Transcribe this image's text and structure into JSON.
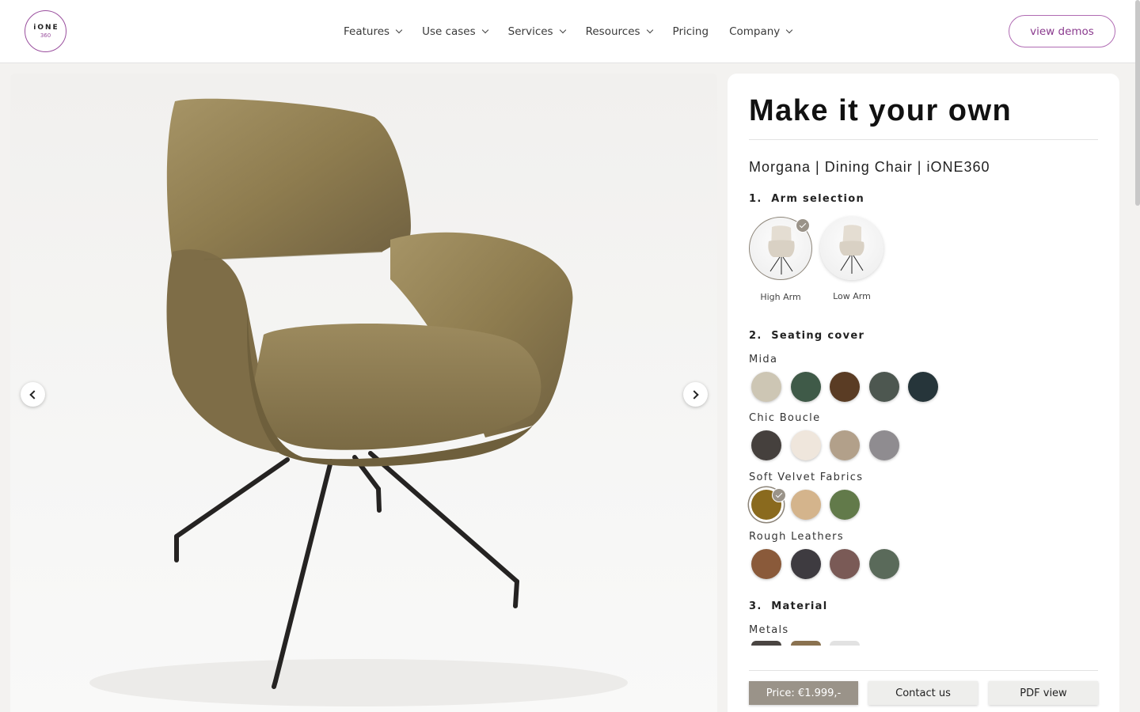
{
  "header": {
    "logo_top": "iONE",
    "logo_bottom": "360",
    "nav": [
      {
        "label": "Features",
        "has_dropdown": true
      },
      {
        "label": "Use cases",
        "has_dropdown": true
      },
      {
        "label": "Services",
        "has_dropdown": true
      },
      {
        "label": "Resources",
        "has_dropdown": true
      },
      {
        "label": "Pricing",
        "has_dropdown": false
      },
      {
        "label": "Company",
        "has_dropdown": true
      }
    ],
    "cta_label": "view demos"
  },
  "viewer": {
    "prev_icon": "chevron-left-icon",
    "next_icon": "chevron-right-icon"
  },
  "config": {
    "title": "Make it your own",
    "product_name": "Morgana | Dining Chair | iONE360",
    "sections": [
      {
        "number": "1.",
        "label": "Arm selection"
      },
      {
        "number": "2.",
        "label": "Seating cover"
      },
      {
        "number": "3.",
        "label": "Material"
      }
    ],
    "arm_options": [
      {
        "label": "High Arm",
        "selected": true
      },
      {
        "label": "Low Arm",
        "selected": false
      }
    ],
    "cover_groups": [
      {
        "name": "Mida",
        "colors": [
          "#cdc6b4",
          "#3f5a48",
          "#5a3c24",
          "#4d5750",
          "#26353a"
        ],
        "selected": null
      },
      {
        "name": "Chic Boucle",
        "colors": [
          "#45403d",
          "#efe6dc",
          "#b2a08a",
          "#8f8c90"
        ],
        "selected": null
      },
      {
        "name": "Soft Velvet Fabrics",
        "colors": [
          "#8a6a1e",
          "#d4b48c",
          "#627a4a"
        ],
        "selected": 0
      },
      {
        "name": "Rough Leathers",
        "colors": [
          "#8a5a3a",
          "#3e3b40",
          "#7a5a56",
          "#5a6a5a"
        ],
        "selected": null
      }
    ],
    "material_groups": [
      {
        "name": "Metals",
        "colors": [
          "#4a4542",
          "#8a7250",
          "#e2e2e2"
        ]
      }
    ],
    "buttons": {
      "price": "Price: €1.999,-",
      "contact": "Contact us",
      "pdf": "PDF view"
    },
    "colors": {
      "accent": "#9a9389",
      "brand": "#9a4f9e"
    }
  }
}
